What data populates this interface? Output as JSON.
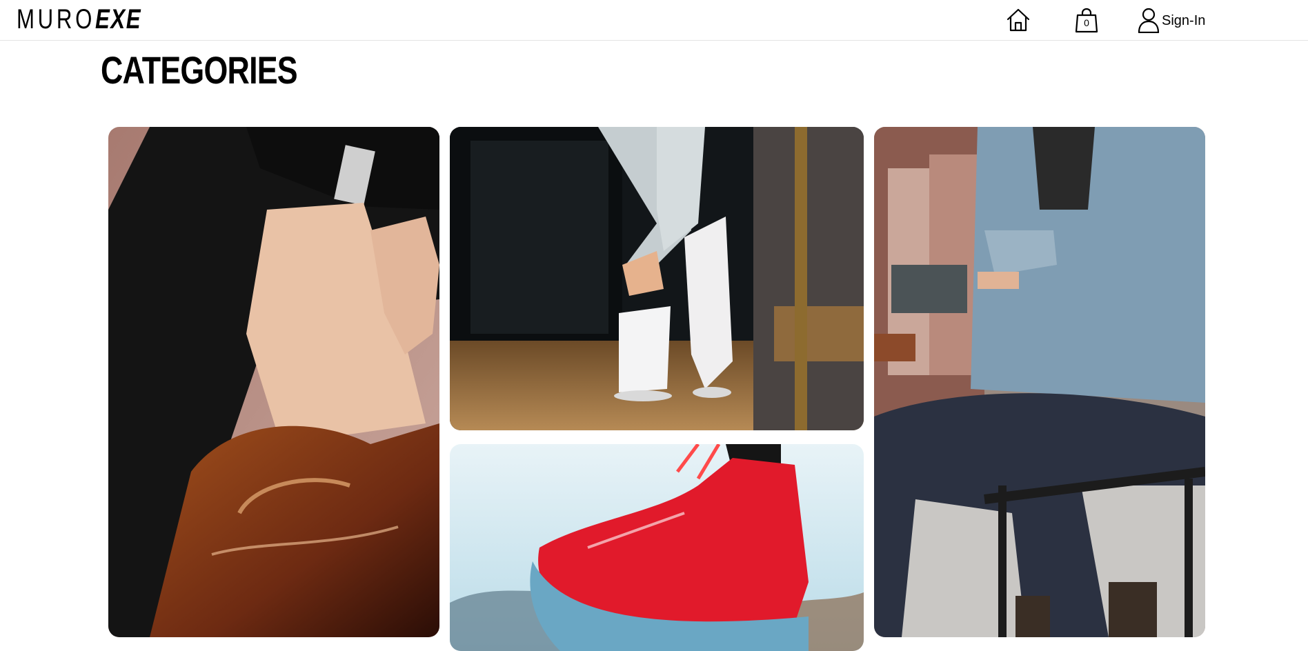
{
  "header": {
    "logo_light": "MURO",
    "logo_bold": "EXE",
    "home_icon": "home-icon",
    "cart_icon": "shopping-bag-icon",
    "cart_count": "0",
    "user_icon": "user-icon",
    "signin_label": "Sign-In"
  },
  "main": {
    "title": "CATEGORIES",
    "categories": [
      {
        "image": "brown patent leather dress shoe on foot"
      },
      {
        "image": "white sneakers with rolled grey trousers"
      },
      {
        "image": "red high-top sneaker against sky"
      },
      {
        "image": "man in denim jacket sitting on street rail"
      }
    ]
  },
  "colors": {
    "text": "#000000",
    "background": "#ffffff",
    "divider": "#e3e3e3"
  }
}
